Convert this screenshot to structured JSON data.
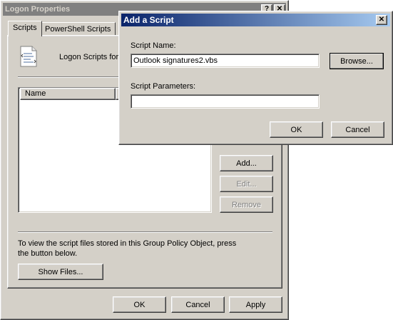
{
  "logon_window": {
    "title": "Logon Properties",
    "help_glyph": "?",
    "close_glyph": "✕",
    "tabs": [
      {
        "label": "Scripts"
      },
      {
        "label": "PowerShell Scripts"
      }
    ],
    "header_text": "Logon Scripts for I",
    "list_columns": [
      {
        "label": "Name"
      },
      {
        "label": ""
      }
    ],
    "buttons": {
      "add": "Add...",
      "edit": "Edit...",
      "remove": "Remove",
      "show_files": "Show Files..."
    },
    "info_text": "To view the script files stored in this Group Policy Object, press the button below.",
    "footer_buttons": {
      "ok": "OK",
      "cancel": "Cancel",
      "apply": "Apply"
    }
  },
  "add_script_dialog": {
    "title": "Add a Script",
    "close_glyph": "✕",
    "script_name_label": "Script Name:",
    "script_name_value": "Outlook signatures2.vbs",
    "browse_label": "Browse...",
    "script_params_label": "Script Parameters:",
    "script_params_value": "",
    "ok_label": "OK",
    "cancel_label": "Cancel"
  },
  "colors": {
    "face": "#d4d0c8",
    "active_title_start": "#0a246a",
    "active_title_end": "#a6caf0",
    "inactive_title": "#808080"
  },
  "icons": {
    "script_icon": "script-document-icon"
  }
}
